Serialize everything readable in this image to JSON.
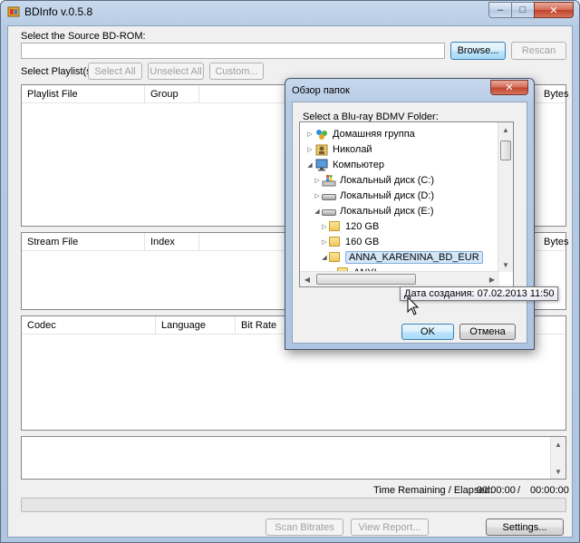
{
  "window": {
    "title": "BDInfo v.0.5.8",
    "minimize": "–",
    "maximize": "□",
    "close": "✕"
  },
  "source": {
    "label": "Select the Source BD-ROM:",
    "path_value": "",
    "browse": "Browse...",
    "rescan": "Rescan"
  },
  "playlists": {
    "label": "Select Playlist(s):",
    "select_all": "Select All",
    "unselect_all": "Unselect All",
    "custom": "Custom...",
    "columns": [
      "Playlist File",
      "Group",
      "Bytes"
    ]
  },
  "streams": {
    "columns": [
      "Stream File",
      "Index",
      "Bytes"
    ]
  },
  "codecs": {
    "columns": [
      "Codec",
      "Language",
      "Bit Rate"
    ]
  },
  "footer": {
    "time_label": "Time Remaining / Elapsed:",
    "time_remaining": "00:00:00",
    "separator": "/",
    "time_elapsed": "00:00:00",
    "progress": 0,
    "scan_bitrates": "Scan Bitrates",
    "view_report": "View Report...",
    "settings": "Settings..."
  },
  "dialog": {
    "title": "Обзор папок",
    "close": "✕",
    "prompt": "Select a Blu-ray BDMV Folder:",
    "tree": [
      {
        "label": "Домашняя группа",
        "expander": "▷",
        "icon": "homegroup-icon"
      },
      {
        "label": "Николай",
        "expander": "▷",
        "icon": "user-icon"
      },
      {
        "label": "Компьютер",
        "expander": "◢",
        "icon": "computer-icon"
      },
      {
        "label": "Локальный диск (C:)",
        "expander": "▷",
        "icon": "windows-drive-icon"
      },
      {
        "label": "Локальный диск (D:)",
        "expander": "▷",
        "icon": "drive-icon"
      },
      {
        "label": "Локальный диск (E:)",
        "expander": "◢",
        "icon": "drive-icon"
      },
      {
        "label": "120 GB",
        "expander": "▷",
        "icon": "folder-icon"
      },
      {
        "label": "160 GB",
        "expander": "▷",
        "icon": "folder-icon"
      },
      {
        "label": "ANNA_KARENINA_BD_EUR",
        "expander": "◢",
        "icon": "folder-icon"
      },
      {
        "label": "ANY!",
        "expander": "▷",
        "icon": "folder-icon"
      }
    ],
    "ok": "OK",
    "cancel": "Отмена",
    "tooltip": "Дата создания: 07.02.2013 11:50"
  },
  "colors": {
    "titlebar": "#b5cbe4",
    "selection": "#d3e7f9",
    "close": "#c0432b"
  }
}
